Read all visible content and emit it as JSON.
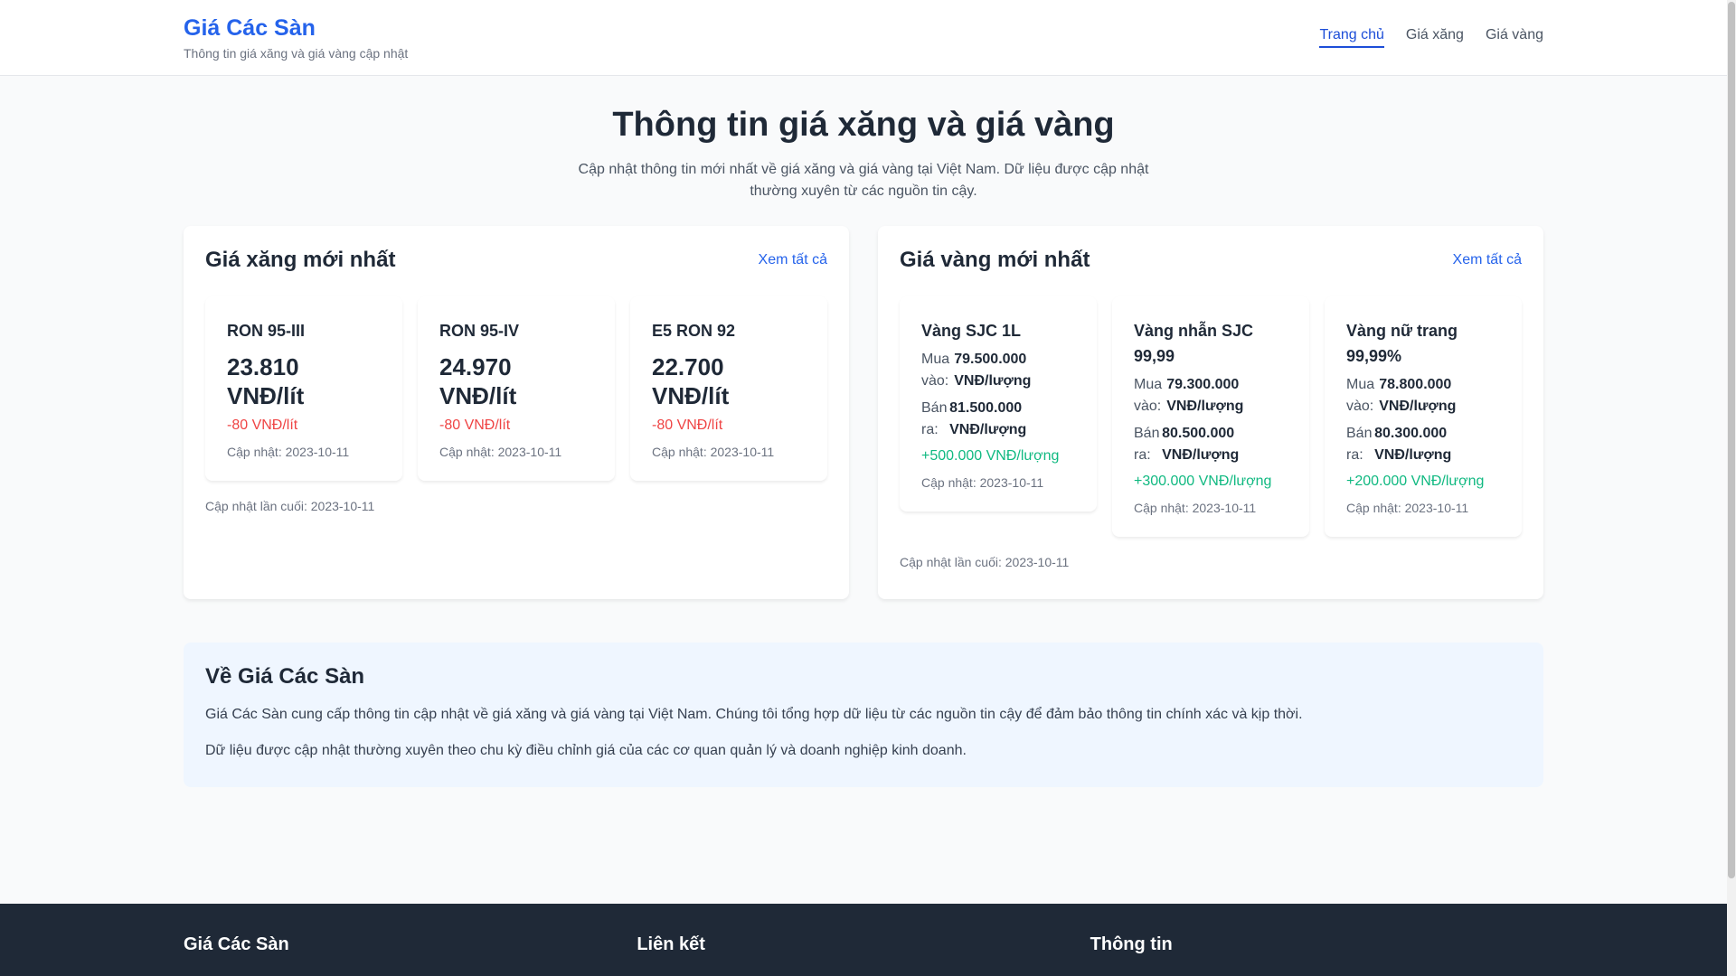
{
  "header": {
    "brand_title": "Giá Các Sàn",
    "brand_subtitle": "Thông tin giá xăng và giá vàng cập nhật",
    "nav": [
      {
        "label": "Trang chủ",
        "active": true
      },
      {
        "label": "Giá xăng",
        "active": false
      },
      {
        "label": "Giá vàng",
        "active": false
      }
    ]
  },
  "hero": {
    "title": "Thông tin giá xăng và giá vàng",
    "description": "Cập nhật thông tin mới nhất về giá xăng và giá vàng tại Việt Nam. Dữ liệu được cập nhật thường xuyên từ các nguồn tin cậy."
  },
  "fuel": {
    "title": "Giá xăng mới nhất",
    "view_all": "Xem tất cả",
    "items": [
      {
        "name": "RON 95-III",
        "price": "23.810 VNĐ/lít",
        "change": "-80 VNĐ/lít",
        "updated": "Cập nhật: 2023-10-11"
      },
      {
        "name": "RON 95-IV",
        "price": "24.970 VNĐ/lít",
        "change": "-80 VNĐ/lít",
        "updated": "Cập nhật: 2023-10-11"
      },
      {
        "name": "E5 RON 92",
        "price": "22.700 VNĐ/lít",
        "change": "-80 VNĐ/lít",
        "updated": "Cập nhật: 2023-10-11"
      }
    ],
    "last_update": "Cập nhật lần cuối: 2023-10-11"
  },
  "gold": {
    "title": "Giá vàng mới nhất",
    "view_all": "Xem tất cả",
    "buy_label": "Mua vào:",
    "sell_label": "Bán ra:",
    "items": [
      {
        "name": "Vàng SJC 1L",
        "buy": "79.500.000 VNĐ/lượng",
        "sell": "81.500.000 VNĐ/lượng",
        "change": "+500.000 VNĐ/lượng",
        "updated": "Cập nhật: 2023-10-11"
      },
      {
        "name": "Vàng nhẫn SJC 99,99",
        "buy": "79.300.000 VNĐ/lượng",
        "sell": "80.500.000 VNĐ/lượng",
        "change": "+300.000 VNĐ/lượng",
        "updated": "Cập nhật: 2023-10-11"
      },
      {
        "name": "Vàng nữ trang 99,99%",
        "buy": "78.800.000 VNĐ/lượng",
        "sell": "80.300.000 VNĐ/lượng",
        "change": "+200.000 VNĐ/lượng",
        "updated": "Cập nhật: 2023-10-11"
      }
    ],
    "last_update": "Cập nhật lần cuối: 2023-10-11"
  },
  "about": {
    "title": "Về Giá Các Sàn",
    "paragraph1": "Giá Các Sàn cung cấp thông tin cập nhật về giá xăng và giá vàng tại Việt Nam. Chúng tôi tổng hợp dữ liệu từ các nguồn tin cậy để đảm bảo thông tin chính xác và kịp thời.",
    "paragraph2": "Dữ liệu được cập nhật thường xuyên theo chu kỳ điều chỉnh giá của các cơ quan quản lý và doanh nghiệp kinh doanh."
  },
  "footer": {
    "col1_title": "Giá Các Sàn",
    "col2_title": "Liên kết",
    "col3_title": "Thông tin"
  },
  "colors": {
    "brand": "#2563eb",
    "decrease": "#ef4444",
    "increase": "#10b981",
    "footer_bg": "#1f2937"
  }
}
